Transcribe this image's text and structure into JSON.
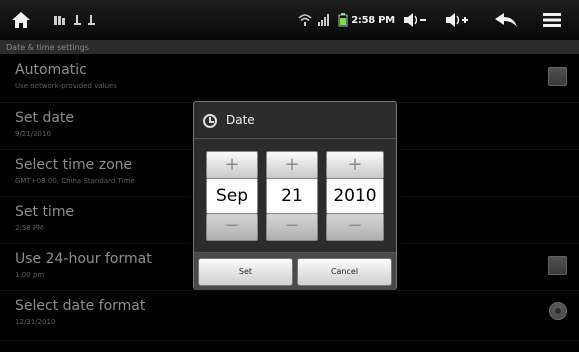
{
  "statusbar": {
    "time": "2:58 PM"
  },
  "header": {
    "title": "Date & time settings"
  },
  "settings": {
    "automatic": {
      "title": "Automatic",
      "summary": "Use network-provided values"
    },
    "set_date": {
      "title": "Set date",
      "summary": "9/21/2010"
    },
    "time_zone": {
      "title": "Select time zone",
      "summary": "GMT+08:00, China Standard Time"
    },
    "set_time": {
      "title": "Set time",
      "summary": "2:58 PM"
    },
    "hour24": {
      "title": "Use 24-hour format",
      "summary": "1:00 pm"
    },
    "date_format": {
      "title": "Select date format",
      "summary": "12/31/2010"
    }
  },
  "dialog": {
    "title": "Date",
    "month": "Sep",
    "day": "21",
    "year": "2010",
    "increment_symbol": "+",
    "decrement_symbol": "−",
    "set_label": "Set",
    "cancel_label": "Cancel"
  },
  "icons": {
    "home": "home-icon",
    "notifications": "notification-icons",
    "wifi": "wifi-icon",
    "signal": "signal-icon",
    "battery": "battery-icon",
    "volume_down": "volume-down-icon",
    "volume_up": "volume-up-icon",
    "back": "back-icon",
    "menu": "menu-icon"
  }
}
